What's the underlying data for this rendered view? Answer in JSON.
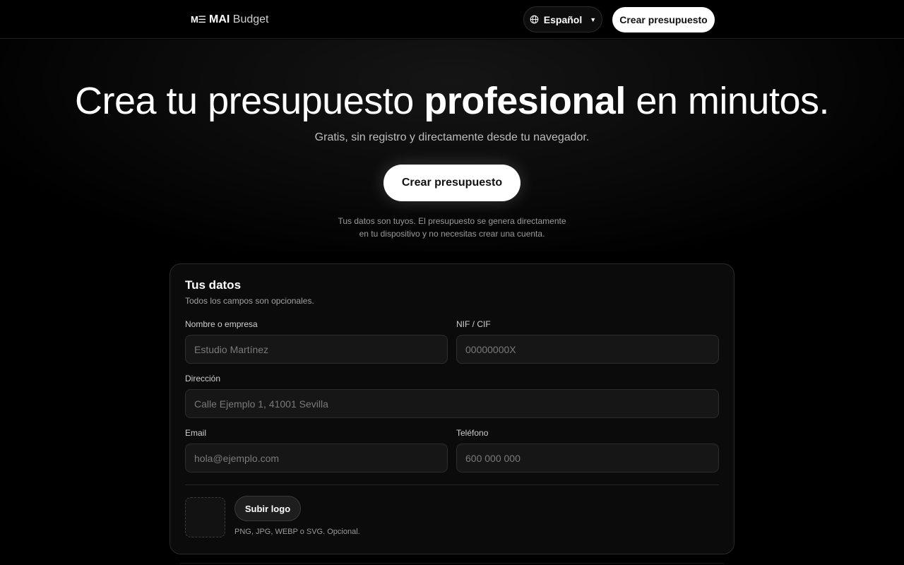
{
  "header": {
    "logo_mark": "M☰",
    "brand_bold": "MAI",
    "brand_light": "Budget",
    "language": "Español",
    "cta_label": "Crear presupuesto"
  },
  "hero": {
    "title_pre": "Crea tu presupuesto ",
    "title_bold": "profesional",
    "title_post": " en minutos.",
    "subtitle": "Gratis, sin registro y directamente desde tu navegador.",
    "cta_label": "Crear presupuesto",
    "privacy_line1": "Tus datos son tuyos. El presupuesto se genera directamente",
    "privacy_line2": "en tu dispositivo y no necesitas crear una cuenta."
  },
  "form": {
    "title": "Tus datos",
    "subtitle": "Todos los campos son opcionales.",
    "company": {
      "label": "Nombre o empresa",
      "placeholder": "Estudio Martínez"
    },
    "taxid": {
      "label": "NIF / CIF",
      "placeholder": "00000000X"
    },
    "address": {
      "label": "Dirección",
      "placeholder": "Calle Ejemplo 1, 41001 Sevilla"
    },
    "email": {
      "label": "Email",
      "placeholder": "hola@ejemplo.com"
    },
    "phone": {
      "label": "Teléfono",
      "placeholder": "600 000 000"
    },
    "logo": {
      "upload_label": "Subir logo",
      "hint": "PNG, JPG, WEBP o SVG. Opcional."
    }
  },
  "colors": {
    "background": "#000000",
    "card": "#0b0b0b",
    "input": "#161616",
    "accent": "#ffffff"
  },
  "icons": {
    "language": "globe-icon",
    "dropdown": "caret-down-icon"
  }
}
